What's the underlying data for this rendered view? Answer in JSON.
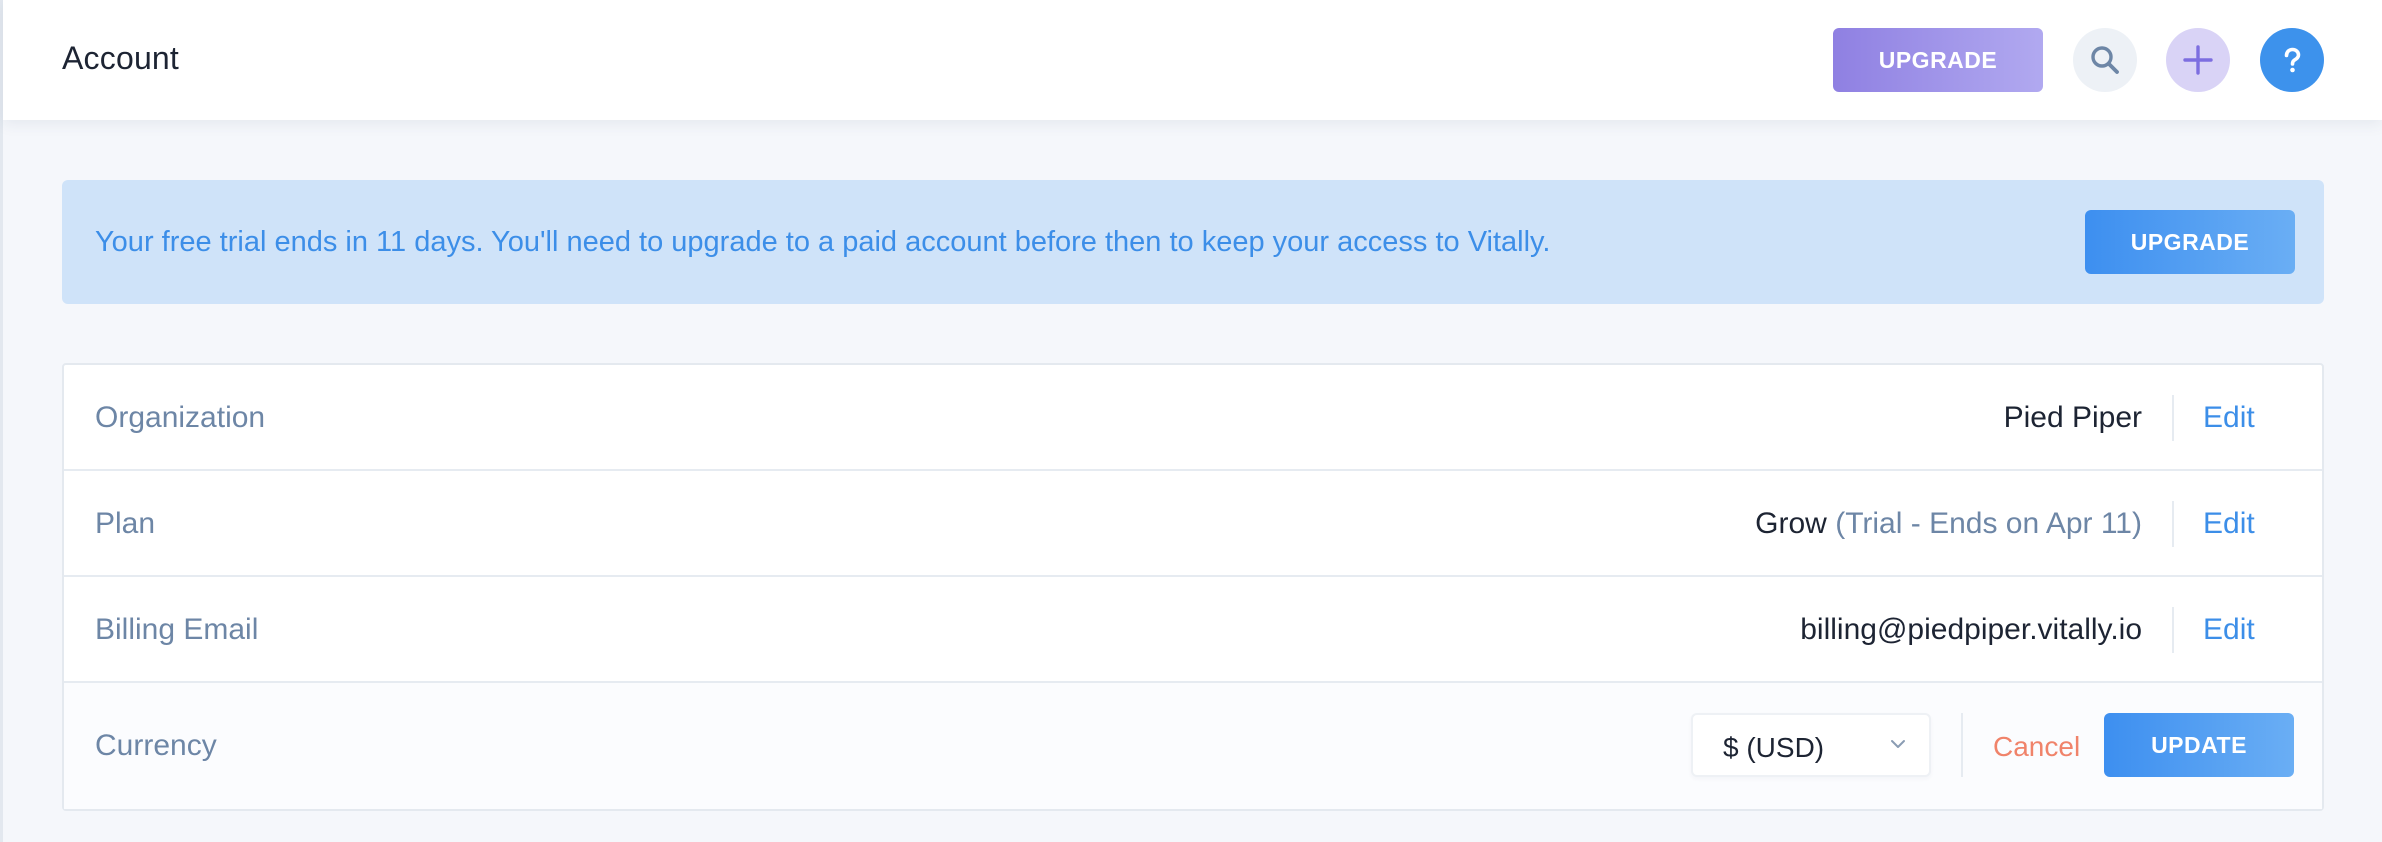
{
  "header": {
    "title": "Account",
    "upgrade_label": "UPGRADE",
    "icons": {
      "search": "search-icon",
      "add": "plus-icon",
      "help": "question-mark-icon"
    }
  },
  "banner": {
    "message": "Your free trial ends in 11 days. You'll need to upgrade to a paid account before then to keep your access to Vitally.",
    "upgrade_label": "UPGRADE"
  },
  "settings": {
    "organization": {
      "label": "Organization",
      "value": "Pied Piper",
      "edit_label": "Edit"
    },
    "plan": {
      "label": "Plan",
      "value": "Grow",
      "detail": "(Trial - Ends on Apr 11)",
      "edit_label": "Edit"
    },
    "billing_email": {
      "label": "Billing Email",
      "value": "billing@piedpiper.vitally.io",
      "edit_label": "Edit"
    },
    "currency": {
      "label": "Currency",
      "selected": "$ (USD)",
      "cancel_label": "Cancel",
      "update_label": "UPDATE"
    }
  },
  "colors": {
    "accent": "#3c8ee8",
    "upgrade_purple": "#8f80e2",
    "banner_bg": "#cfe3f9",
    "cancel": "#f0836a",
    "label_gray": "#6d86a6"
  }
}
